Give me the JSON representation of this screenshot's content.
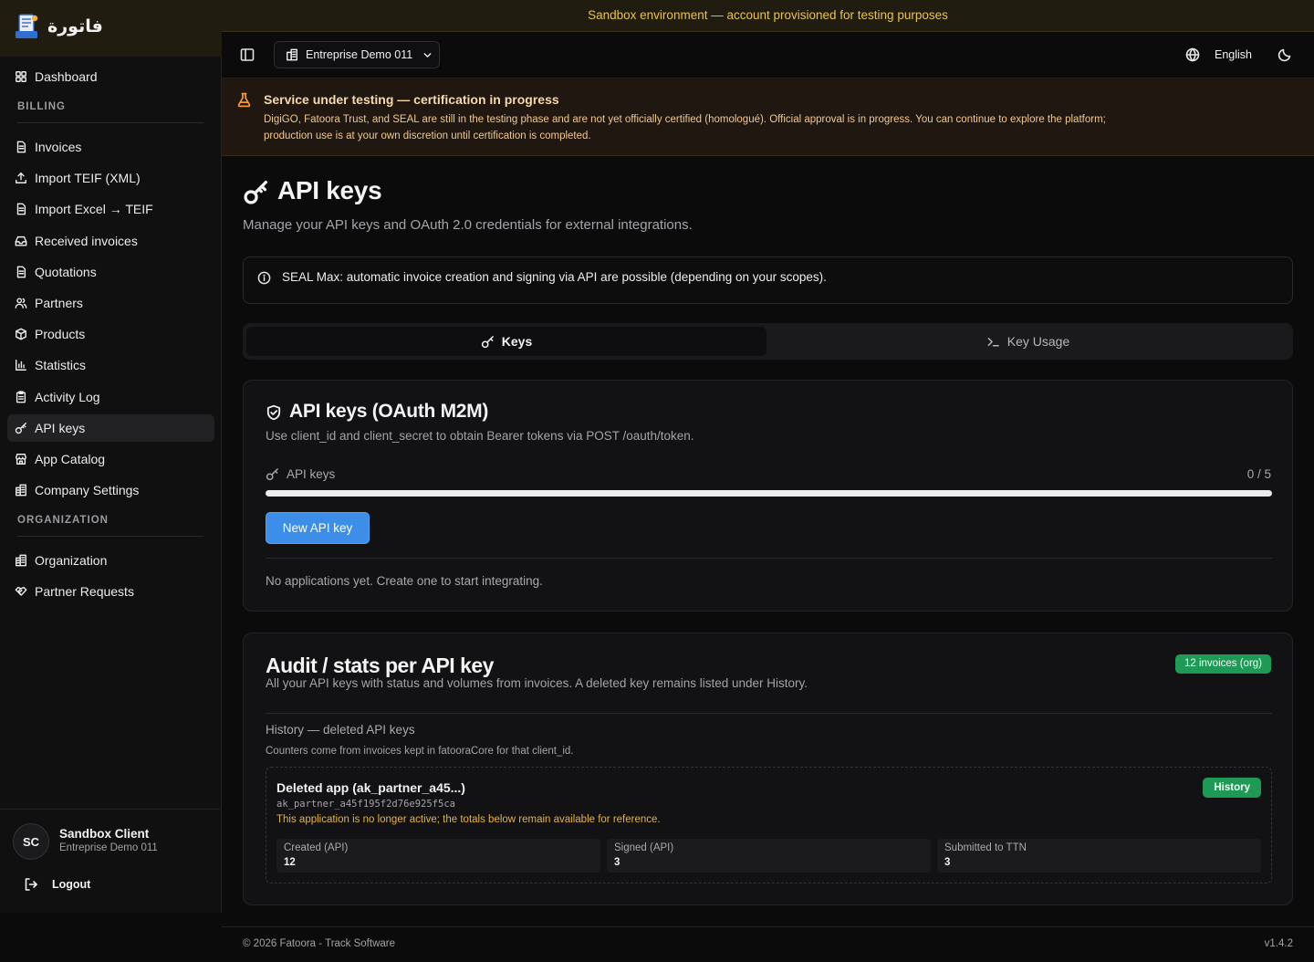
{
  "brand": {
    "name": "فاتورة"
  },
  "sandbox_banner": "Sandbox environment — account provisioned for testing purposes",
  "sidebar": {
    "items": [
      {
        "label": "Dashboard",
        "icon": "grid-icon"
      },
      {
        "label": "Invoices",
        "icon": "document-icon"
      },
      {
        "label": "Import TEIF (XML)",
        "icon": "upload-icon"
      },
      {
        "label": "Import Excel → TEIF",
        "icon": "document-icon"
      },
      {
        "label": "Received invoices",
        "icon": "inbox-icon"
      },
      {
        "label": "Quotations",
        "icon": "document-icon"
      },
      {
        "label": "Partners",
        "icon": "users-icon"
      },
      {
        "label": "Products",
        "icon": "package-icon"
      },
      {
        "label": "Statistics",
        "icon": "bar-chart-icon"
      },
      {
        "label": "Activity Log",
        "icon": "clipboard-icon"
      },
      {
        "label": "API keys",
        "icon": "key-icon",
        "active": true
      },
      {
        "label": "App Catalog",
        "icon": "store-icon"
      },
      {
        "label": "Company Settings",
        "icon": "building-icon"
      },
      {
        "label": "Organization",
        "icon": "building-icon"
      },
      {
        "label": "Partner Requests",
        "icon": "handshake-icon"
      }
    ],
    "sections": {
      "billing": "BILLING",
      "organization": "ORGANIZATION"
    },
    "user": {
      "initials": "SC",
      "name": "Sandbox Client",
      "org": "Entreprise Demo 011"
    },
    "logout": "Logout"
  },
  "topbar": {
    "company": "Entreprise Demo 011",
    "language": "English"
  },
  "warning": {
    "title": "Service under testing — certification in progress",
    "text": "DigiGO, Fatoora Trust, and SEAL are still in the testing phase and are not yet officially certified (homologué). Official approval is in progress. You can continue to explore the platform; production use is at your own discretion until certification is completed."
  },
  "page": {
    "title": "API keys",
    "subtitle": "Manage your API keys and OAuth 2.0 credentials for external integrations.",
    "info": "SEAL Max: automatic invoice creation and signing via API are possible (depending on your scopes)."
  },
  "tabs": {
    "keys": "Keys",
    "usage": "Key Usage"
  },
  "oauth_card": {
    "title": "API keys (OAuth M2M)",
    "subtitle": "Use client_id and client_secret to obtain Bearer tokens via POST /oauth/token.",
    "usage_label": "API keys",
    "usage_count": "0 / 5",
    "usage_fraction": 0,
    "new_button": "New API key",
    "empty": "No applications yet. Create one to start integrating."
  },
  "audit_card": {
    "title": "Audit / stats per API key",
    "subtitle": "All your API keys with status and volumes from invoices. A deleted key remains listed under History.",
    "badge": "12 invoices (org)",
    "history_title": "History — deleted API keys",
    "history_note": "Counters come from invoices kept in fatooraCore for that client_id.",
    "deleted": {
      "name": "Deleted app (ak_partner_a45...)",
      "client_id": "ak_partner_a45f195f2d76e925f5ca",
      "warning": "This application is no longer active; the totals below remain available for reference.",
      "badge": "History",
      "stats": [
        {
          "label": "Created (API)",
          "value": "12"
        },
        {
          "label": "Signed (API)",
          "value": "3"
        },
        {
          "label": "Submitted to TTN",
          "value": "3"
        }
      ]
    }
  },
  "footer": {
    "copyright": "© 2026 Fatoora - Track Software",
    "version": "v1.4.2"
  },
  "colors": {
    "accent": "#3d8ee8",
    "success": "#1f9a56",
    "warning": "#f59a3c",
    "banner": "#e9c44c"
  }
}
